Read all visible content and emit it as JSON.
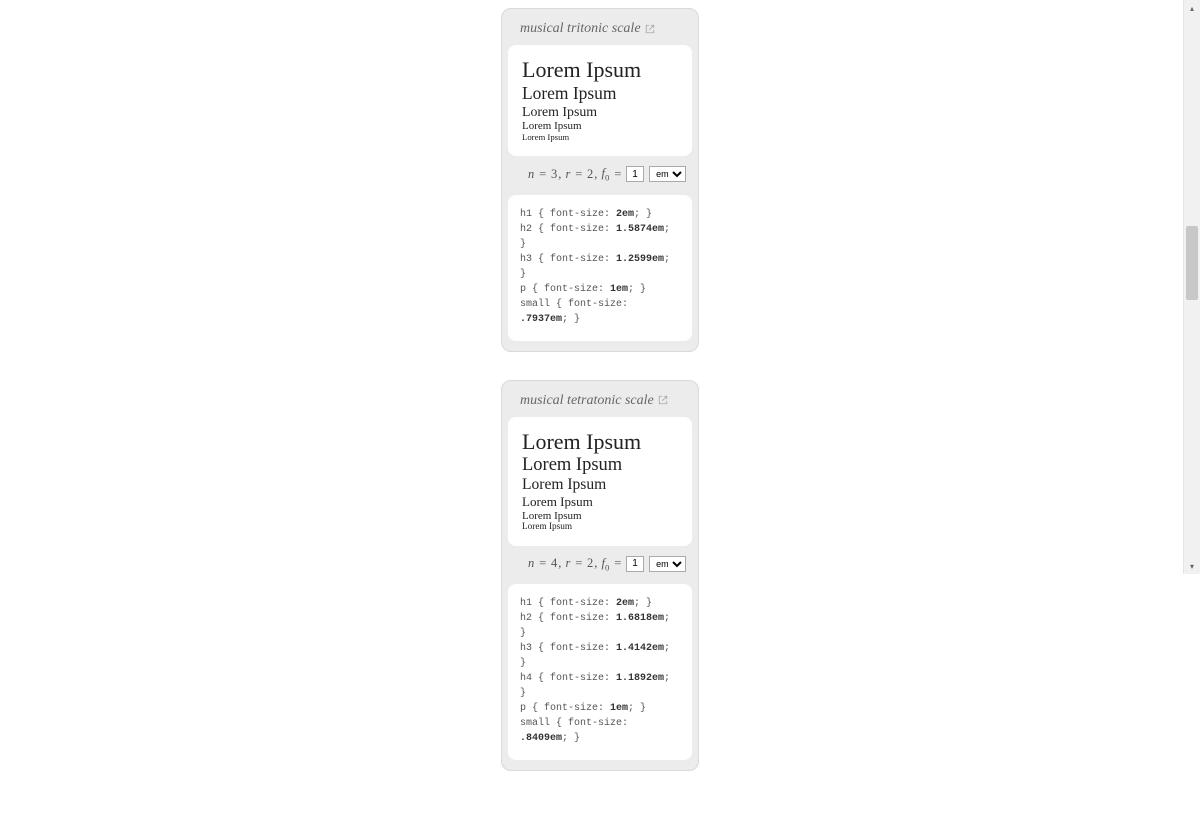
{
  "sample_text": "Lorem Ipsum",
  "cards": [
    {
      "title": "musical tritonic scale",
      "n": "3",
      "r": "2",
      "f0_value": "1",
      "unit": "em",
      "sizes_em": [
        "2em",
        "1.5874em",
        "1.2599em",
        "1em",
        ".7937em"
      ],
      "css": [
        {
          "sel": "h1",
          "size": "2em"
        },
        {
          "sel": "h2",
          "size": "1.5874em"
        },
        {
          "sel": "h3",
          "size": "1.2599em"
        },
        {
          "sel": "p",
          "size": "1em"
        },
        {
          "sel": "small",
          "size": ".7937em"
        }
      ]
    },
    {
      "title": "musical tetratonic scale",
      "n": "4",
      "r": "2",
      "f0_value": "1",
      "unit": "em",
      "sizes_em": [
        "2em",
        "1.6818em",
        "1.4142em",
        "1.1892em",
        "1em",
        ".8409em"
      ],
      "css": [
        {
          "sel": "h1",
          "size": "2em"
        },
        {
          "sel": "h2",
          "size": "1.6818em"
        },
        {
          "sel": "h3",
          "size": "1.4142em"
        },
        {
          "sel": "h4",
          "size": "1.1892em"
        },
        {
          "sel": "p",
          "size": "1em"
        },
        {
          "sel": "small",
          "size": ".8409em"
        }
      ]
    }
  ],
  "formula_labels": {
    "n": "n",
    "r": "r",
    "f0": "f",
    "f0_sub": "0",
    "eq": "="
  }
}
